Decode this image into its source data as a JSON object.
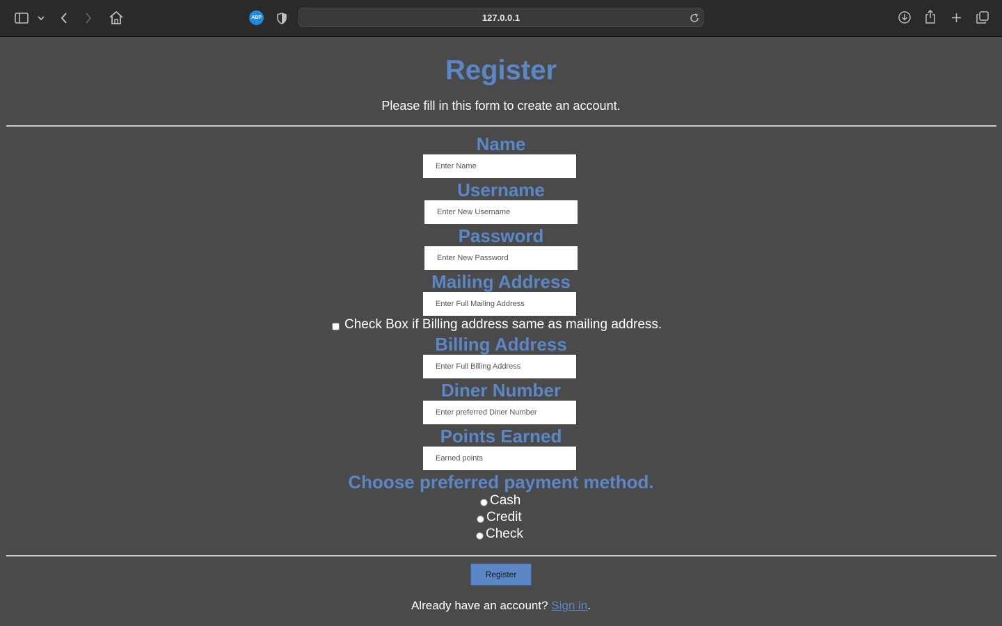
{
  "browser": {
    "url": "127.0.0.1",
    "abp_label": "ABP"
  },
  "page": {
    "title": "Register",
    "subtitle": "Please fill in this form to create an account.",
    "fields": {
      "name": {
        "label": "Name",
        "placeholder": "Enter Name"
      },
      "username": {
        "label": "Username",
        "placeholder": "Enter New Username"
      },
      "password": {
        "label": "Password",
        "placeholder": "Enter New Password"
      },
      "mailing": {
        "label": "Mailing Address",
        "placeholder": "Enter Full Mailing Address"
      },
      "billing": {
        "label": "Billing Address",
        "placeholder": "Enter Full Billing Address"
      },
      "diner": {
        "label": "Diner Number",
        "placeholder": "Enter preferred Diner Number"
      },
      "points": {
        "label": "Points Earned",
        "placeholder": "Earned points"
      }
    },
    "same_address_checkbox": "Check Box if Billing address same as mailing address.",
    "payment": {
      "label": "Choose preferred payment method.",
      "options": [
        "Cash",
        "Credit",
        "Check"
      ]
    },
    "register_button": "Register",
    "signin_prompt": "Already have an account?",
    "signin_link": "Sign in",
    "signin_period": "."
  },
  "colors": {
    "accent": "#5b87c7",
    "background": "#4a4a4a",
    "toolbar": "#2b2a29"
  }
}
